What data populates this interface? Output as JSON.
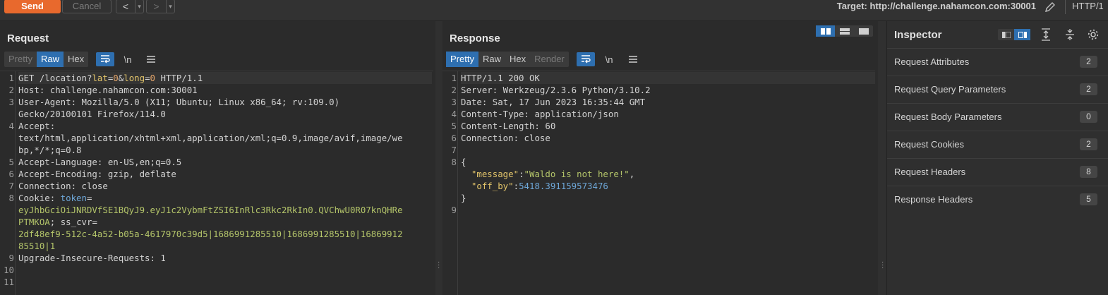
{
  "toolbar": {
    "send_label": "Send",
    "cancel_label": "Cancel",
    "back_label": "<",
    "forward_label": ">",
    "target": "Target: http://challenge.nahamcon.com:30001",
    "http_version": "HTTP/1"
  },
  "request": {
    "title": "Request",
    "tabs": [
      "Pretty",
      "Raw",
      "Hex"
    ],
    "active_tab": "Raw",
    "wrap_icon": "wrap-icon",
    "newline_label": "\\n",
    "menu_icon": "hamburger-icon",
    "line_numbers": [
      "1",
      "2",
      "3",
      "",
      "4",
      "",
      "",
      "5",
      "6",
      "7",
      "8",
      "",
      "",
      "",
      "",
      "9",
      "10",
      "11"
    ],
    "lines": {
      "l1_method": "GET /location?",
      "l1_p1k": "lat",
      "l1_eq1": "=",
      "l1_p1v": "0",
      "l1_amp": "&",
      "l1_p2k": "long",
      "l1_eq2": "=",
      "l1_p2v": "0",
      "l1_proto": " HTTP/1.1",
      "l2_k": "Host:",
      "l2_v": " challenge.nahamcon.com:30001",
      "l3_k": "User-Agent:",
      "l3_v": " Mozilla/5.0 (X11; Ubuntu; Linux x86_64; rv:109.0)",
      "l3_v2": "Gecko/20100101 Firefox/114.0",
      "l4_k": "Accept:",
      "l4_v1": "text/html,application/xhtml+xml,application/xml;q=0.9,image/avif,image/we",
      "l4_v2": "bp,*/*;q=0.8",
      "l5_k": "Accept-Language:",
      "l5_v": " en-US,en;q=0.5",
      "l6_k": "Accept-Encoding:",
      "l6_v": " gzip, deflate",
      "l7_k": "Connection:",
      "l7_v": " close",
      "l8_k": "Cookie:",
      "l8_c1": " token",
      "l8_eq": "=",
      "l8_tok1": "eyJhbGciOiJNRDVfSE1BQyJ9.eyJ1c2VybmFtZSI6InRlc3Rkc2RkIn0.QVChwU0R07knQHRe",
      "l8_tok2": "PTMKOA",
      "l8_semi": "; ",
      "l8_c2": "ss_cvr",
      "l8_eq2": "=",
      "l8_v1": "2df48ef9-512c-4a52-b05a-4617970c39d5|1686991285510|1686991285510|16869912",
      "l8_v2": "85510|1",
      "l9_k": "Upgrade-Insecure-Requests:",
      "l9_v": " 1"
    }
  },
  "response": {
    "title": "Response",
    "tabs": [
      "Pretty",
      "Raw",
      "Hex",
      "Render"
    ],
    "active_tab": "Pretty",
    "newline_label": "\\n",
    "line_numbers": [
      "1",
      "2",
      "3",
      "4",
      "5",
      "6",
      "7",
      "8",
      "",
      "",
      "",
      "9"
    ],
    "lines": {
      "l1": "HTTP/1.1 200 OK",
      "l2_k": "Server:",
      "l2_v": " Werkzeug/2.3.6 Python/3.10.2",
      "l3_k": "Date:",
      "l3_v": " Sat, 17 Jun 2023 16:35:44 GMT",
      "l4_k": "Content-Type:",
      "l4_v": " application/json",
      "l5_k": "Content-Length:",
      "l5_v": " 60",
      "l6_k": "Connection:",
      "l6_v": " close",
      "l8_open": "{",
      "j1_k": "\"message\"",
      "j1_colon": ":",
      "j1_v": "\"Waldo is not here!\"",
      "j1_comma": ",",
      "j2_k": "\"off_by\"",
      "j2_colon": ":",
      "j2_v": "5418.391159573476",
      "l8_close": "}"
    }
  },
  "inspector": {
    "title": "Inspector",
    "rows": [
      {
        "label": "Request Attributes",
        "count": "2"
      },
      {
        "label": "Request Query Parameters",
        "count": "2"
      },
      {
        "label": "Request Body Parameters",
        "count": "0"
      },
      {
        "label": "Request Cookies",
        "count": "2"
      },
      {
        "label": "Request Headers",
        "count": "8"
      },
      {
        "label": "Response Headers",
        "count": "5"
      }
    ]
  },
  "colors": {
    "accent": "#e8692d",
    "selected": "#2e6fb0",
    "cookie_value": "#b4c56a",
    "json_number": "#6ea7d8"
  }
}
